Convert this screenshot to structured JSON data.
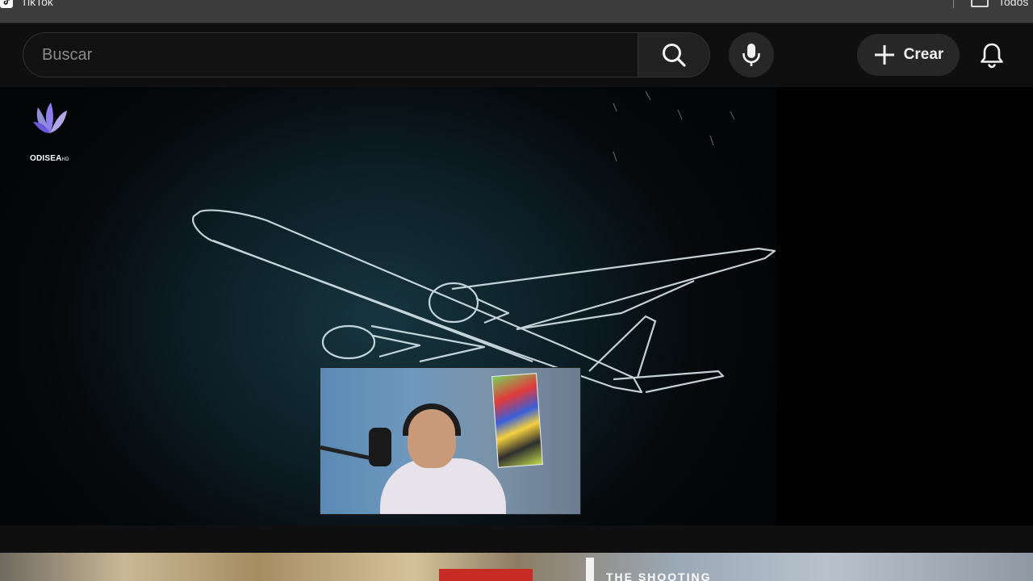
{
  "bookmarks": {
    "items": [
      {
        "label": "TikTok",
        "icon": "tiktok-icon"
      },
      {
        "label": "Todos",
        "icon": "folder-icon"
      }
    ]
  },
  "header": {
    "search": {
      "placeholder": "Buscar",
      "value": ""
    },
    "create_label": "Crear",
    "icons": [
      "search-icon",
      "microphone-icon",
      "plus-icon",
      "bell-icon"
    ]
  },
  "video": {
    "channel_logo": {
      "name": "ODISEA",
      "suffix": "HD"
    }
  },
  "next_video": {
    "title": "THE SHOOTING"
  },
  "colors": {
    "background": "#0f0f0f",
    "search_border": "#303030",
    "button_bg": "#272727",
    "accent_red": "#c62b24"
  }
}
